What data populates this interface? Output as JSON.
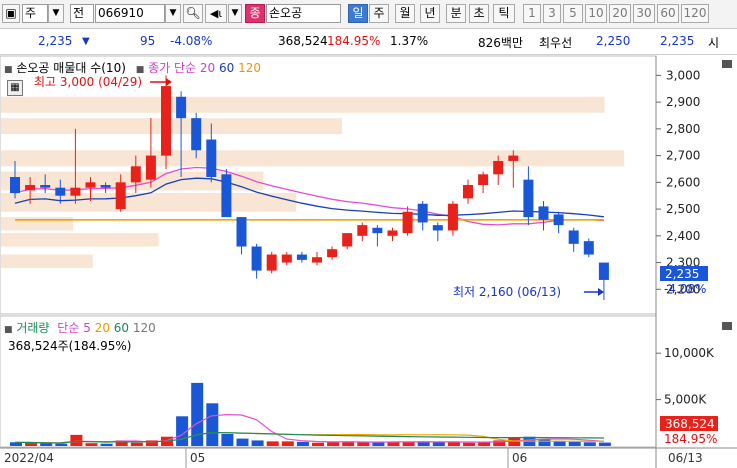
{
  "toolbar": {
    "market_type": "주",
    "period_type": "전",
    "stock_code": "066910",
    "stock_badge": "종",
    "stock_name": "손오공",
    "periods": [
      "일",
      "주",
      "월",
      "년",
      "분",
      "초",
      "틱"
    ],
    "selected_period": "일",
    "minute_intervals": [
      "1",
      "3",
      "5",
      "10",
      "20",
      "30",
      "60",
      "120"
    ]
  },
  "quote": {
    "price": "2,235",
    "change": "95",
    "change_pct": "-4.08%",
    "volume": "368,524",
    "volume_ratio": "184.95%",
    "turnover": "1.37%",
    "amount": "826백만",
    "best_ask_label": "최우선",
    "best_ask": "2,250",
    "best_bid": "2,235",
    "trailing": "시"
  },
  "price_panel": {
    "legend_stock": "손오공 매물대 수(10)",
    "legend_ma_label": "종가 단순",
    "legend_ma": [
      "20",
      "60",
      "120"
    ],
    "high_label": "최고 3,000 (04/29)",
    "low_label": "최저 2,160 (06/13)",
    "y_ticks": [
      "3,000",
      "2,900",
      "2,800",
      "2,700",
      "2,600",
      "2,500",
      "2,400",
      "2,300",
      "2,200"
    ],
    "last_price_tag": "2,235",
    "last_pct_tag": "-4.08%"
  },
  "volume_panel": {
    "legend_label": "거래량",
    "legend_ma_label": "단순",
    "legend_ma": [
      "5",
      "20",
      "60",
      "120"
    ],
    "current": "368,524주(184.95%)",
    "y_ticks": [
      "10,000K",
      "5,000K"
    ],
    "last_volume_tag": "368,524",
    "last_pct_tag": "184.95%"
  },
  "x_axis": {
    "labels": [
      "2022/04",
      "05",
      "06",
      "06/13"
    ]
  },
  "colors": {
    "up": "#e8211b",
    "down": "#1a57d6",
    "ma20": "#e24fd0",
    "ma60": "#1a3fb0",
    "ma120": "#f0a500",
    "profile": "#f8e5d3"
  },
  "chart_data": {
    "type": "candlestick",
    "y_range": [
      2160,
      3050
    ],
    "candles": [
      {
        "o": 2620,
        "h": 2680,
        "l": 2540,
        "c": 2560
      },
      {
        "o": 2570,
        "h": 2620,
        "l": 2520,
        "c": 2590
      },
      {
        "o": 2590,
        "h": 2630,
        "l": 2560,
        "c": 2580
      },
      {
        "o": 2580,
        "h": 2610,
        "l": 2520,
        "c": 2550
      },
      {
        "o": 2550,
        "h": 2800,
        "l": 2520,
        "c": 2580
      },
      {
        "o": 2580,
        "h": 2620,
        "l": 2530,
        "c": 2600
      },
      {
        "o": 2590,
        "h": 2600,
        "l": 2560,
        "c": 2580
      },
      {
        "o": 2500,
        "h": 2630,
        "l": 2490,
        "c": 2600
      },
      {
        "o": 2600,
        "h": 2700,
        "l": 2560,
        "c": 2660
      },
      {
        "o": 2610,
        "h": 2840,
        "l": 2580,
        "c": 2700
      },
      {
        "o": 2700,
        "h": 3000,
        "l": 2650,
        "c": 2960
      },
      {
        "o": 2920,
        "h": 2940,
        "l": 2620,
        "c": 2840
      },
      {
        "o": 2840,
        "h": 2860,
        "l": 2690,
        "c": 2720
      },
      {
        "o": 2760,
        "h": 2820,
        "l": 2600,
        "c": 2620
      },
      {
        "o": 2630,
        "h": 2650,
        "l": 2500,
        "c": 2470
      },
      {
        "o": 2470,
        "h": 2470,
        "l": 2330,
        "c": 2360
      },
      {
        "o": 2360,
        "h": 2370,
        "l": 2240,
        "c": 2270
      },
      {
        "o": 2270,
        "h": 2340,
        "l": 2260,
        "c": 2330
      },
      {
        "o": 2300,
        "h": 2340,
        "l": 2290,
        "c": 2330
      },
      {
        "o": 2330,
        "h": 2340,
        "l": 2300,
        "c": 2310
      },
      {
        "o": 2300,
        "h": 2340,
        "l": 2290,
        "c": 2320
      },
      {
        "o": 2320,
        "h": 2360,
        "l": 2310,
        "c": 2350
      },
      {
        "o": 2360,
        "h": 2410,
        "l": 2350,
        "c": 2410
      },
      {
        "o": 2400,
        "h": 2450,
        "l": 2380,
        "c": 2440
      },
      {
        "o": 2430,
        "h": 2440,
        "l": 2360,
        "c": 2410
      },
      {
        "o": 2400,
        "h": 2430,
        "l": 2380,
        "c": 2420
      },
      {
        "o": 2410,
        "h": 2510,
        "l": 2400,
        "c": 2490
      },
      {
        "o": 2520,
        "h": 2530,
        "l": 2420,
        "c": 2450
      },
      {
        "o": 2440,
        "h": 2450,
        "l": 2380,
        "c": 2420
      },
      {
        "o": 2420,
        "h": 2530,
        "l": 2400,
        "c": 2520
      },
      {
        "o": 2540,
        "h": 2610,
        "l": 2520,
        "c": 2590
      },
      {
        "o": 2590,
        "h": 2640,
        "l": 2560,
        "c": 2630
      },
      {
        "o": 2630,
        "h": 2700,
        "l": 2590,
        "c": 2680
      },
      {
        "o": 2680,
        "h": 2720,
        "l": 2580,
        "c": 2700
      },
      {
        "o": 2610,
        "h": 2660,
        "l": 2440,
        "c": 2470
      },
      {
        "o": 2510,
        "h": 2530,
        "l": 2420,
        "c": 2460
      },
      {
        "o": 2480,
        "h": 2490,
        "l": 2410,
        "c": 2440
      },
      {
        "o": 2420,
        "h": 2430,
        "l": 2340,
        "c": 2370
      },
      {
        "o": 2380,
        "h": 2390,
        "l": 2320,
        "c": 2330
      },
      {
        "o": 2300,
        "h": 2300,
        "l": 2160,
        "c": 2235
      }
    ],
    "volume": [
      400,
      350,
      300,
      250,
      1200,
      300,
      250,
      600,
      350,
      600,
      1000,
      3200,
      6800,
      4600,
      1300,
      800,
      600,
      500,
      500,
      450,
      350,
      400,
      500,
      450,
      400,
      400,
      450,
      500,
      450,
      400,
      350,
      400,
      600,
      950,
      1000,
      700,
      550,
      450,
      400,
      368.524
    ]
  }
}
